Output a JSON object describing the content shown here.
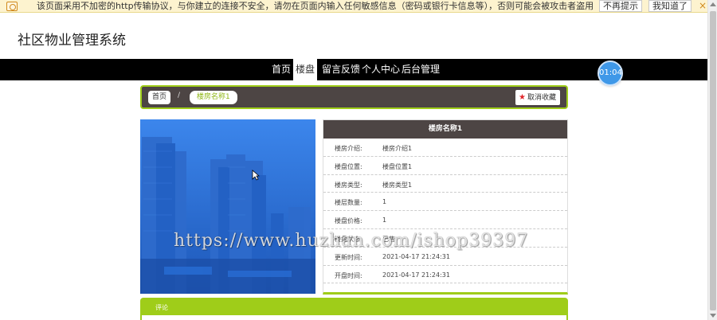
{
  "warning": {
    "text": "该页面采用不加密的http传输协议，与你建立的连接不安全，请勿在页面内输入任何敏感信息（密码或银行卡信息等），否则可能会被攻击者盗用",
    "btn_no_prompt": "不再提示",
    "btn_ok": "我知道了",
    "close": "×"
  },
  "site": {
    "title": "社区物业管理系统"
  },
  "nav": {
    "items": [
      {
        "label": "首页"
      },
      {
        "label": "楼盘"
      },
      {
        "label": "留言反馈"
      },
      {
        "label": "个人中心"
      },
      {
        "label": "后台管理"
      }
    ],
    "active_index": 1
  },
  "clock": "01:04",
  "breadcrumb": {
    "home": "首页",
    "separator": "/",
    "current": "楼房名称1",
    "unfavorite": "取消收藏"
  },
  "detail": {
    "title": "楼房名称1",
    "rows": [
      {
        "key": "楼房介绍:",
        "value": "楼房介绍1"
      },
      {
        "key": "楼盘位置:",
        "value": "楼盘位置1"
      },
      {
        "key": "楼房类型:",
        "value": "楼房类型1"
      },
      {
        "key": "楼层数量:",
        "value": "1"
      },
      {
        "key": "楼盘价格:",
        "value": "1"
      },
      {
        "key": "楼盘状态:",
        "value": "已售"
      },
      {
        "key": "更新时间:",
        "value": "2021-04-17 21:24:31"
      },
      {
        "key": "开盘时间:",
        "value": "2021-04-17 21:24:31"
      }
    ]
  },
  "comments": {
    "title": "评论"
  },
  "watermark": "https://www.huzhan.com/ishop39397",
  "colors": {
    "accent": "#9fcd19",
    "dark": "#4d4544",
    "nav": "#000000",
    "clock": "#3f98e8",
    "star": "#e0262b"
  }
}
